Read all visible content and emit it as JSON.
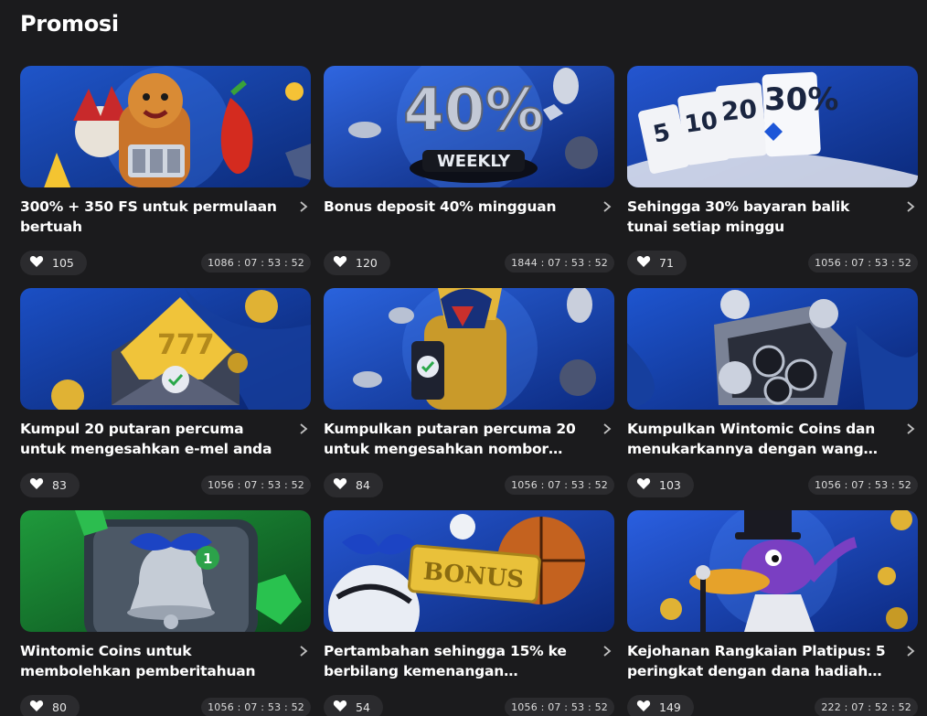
{
  "page": {
    "title": "Promosi"
  },
  "cards": [
    {
      "title": "300% + 350 FS untuk permulaan bertuah",
      "likes": "105",
      "timer": "1086 : 07 : 53 : 52",
      "colors": [
        "#1f55c9",
        "#0c2b7a"
      ]
    },
    {
      "title": "Bonus deposit 40% mingguan",
      "likes": "120",
      "timer": "1844 : 07 : 53 : 52",
      "colors": [
        "#2f66e0",
        "#0a2370"
      ],
      "banner_text": "40%",
      "banner_subtext": "WEEKLY"
    },
    {
      "title": "Sehingga 30% bayaran balik tunai setiap minggu",
      "likes": "71",
      "timer": "1056 : 07 : 53 : 52",
      "colors": [
        "#2456d0",
        "#0b2a7c"
      ],
      "banner_text": "30%"
    },
    {
      "title": "Kumpul 20 putaran percuma untuk mengesahkan e-mel anda",
      "likes": "83",
      "timer": "1056 : 07 : 53 : 52",
      "colors": [
        "#1b4fc4",
        "#0a246e"
      ]
    },
    {
      "title": "Kumpulkan putaran percuma 20 untuk mengesahkan nombor telefon anda",
      "likes": "84",
      "timer": "1056 : 07 : 53 : 52",
      "colors": [
        "#2a63dd",
        "#0c2a80"
      ]
    },
    {
      "title": "Kumpulkan Wintomic Coins dan menukarkannya dengan wang sebenar",
      "likes": "103",
      "timer": "1056 : 07 : 53 : 52",
      "colors": [
        "#1e55cf",
        "#0a2575"
      ]
    },
    {
      "title": "Wintomic Coins untuk membolehkan pemberitahuan",
      "likes": "80",
      "timer": "1056 : 07 : 53 : 52",
      "colors": [
        "#1f9a3c",
        "#0b4a1c"
      ]
    },
    {
      "title": "Pertambahan sehingga 15% ke berbilang kemenangan pertaruhan",
      "likes": "54",
      "timer": "1056 : 07 : 53 : 52",
      "colors": [
        "#2658d4",
        "#0b2778"
      ],
      "banner_text": "BONUS"
    },
    {
      "title": "Kejohanan Rangkaian Platipus: 5 peringkat dengan dana hadiah bernilai",
      "likes": "149",
      "timer": "222 : 07 : 52 : 52",
      "colors": [
        "#2a5fe0",
        "#0c2a82"
      ]
    }
  ],
  "icons": {
    "like": "heart-icon",
    "open": "chevron-right-icon"
  }
}
